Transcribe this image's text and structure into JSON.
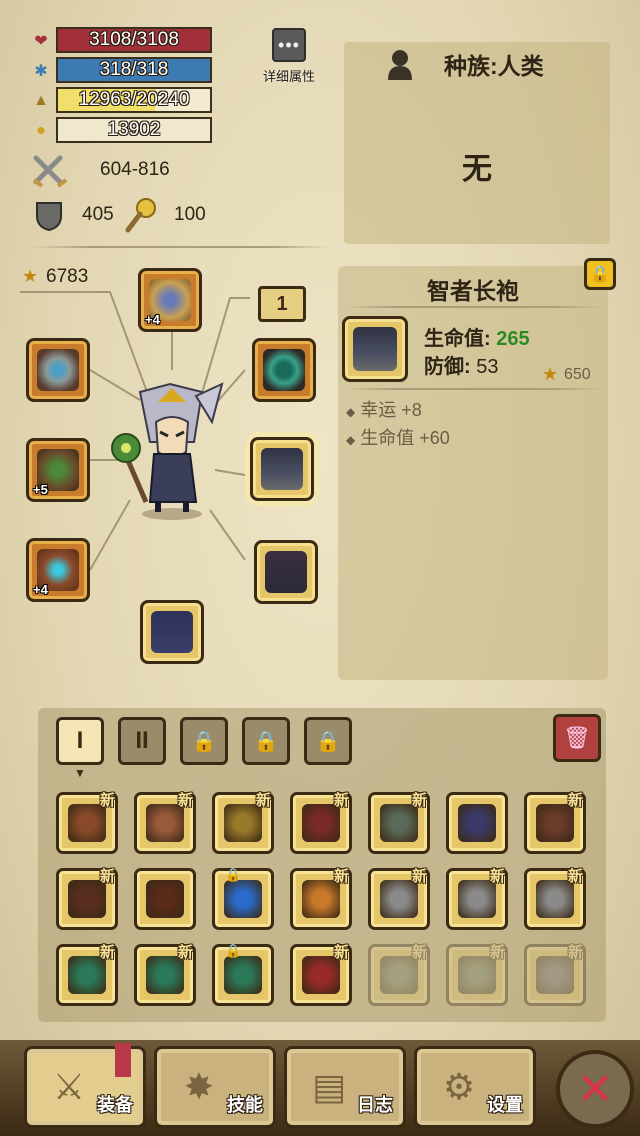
{
  "stats": {
    "hp": "3108/3108",
    "mp": "318/318",
    "exp": "12963/20240",
    "gold": "13902",
    "attack": "604-816",
    "defense": "405",
    "resist": "100",
    "score": "6783"
  },
  "detail_button": {
    "label": "详细属性",
    "icon": "dots-icon"
  },
  "race": {
    "label": "种族:人类",
    "value": "无"
  },
  "hero_slots": {
    "helmet_plus": "+4",
    "weapon_plus": "+5",
    "glove_plus": "+4",
    "level_tag": "1"
  },
  "item_info": {
    "name": "智者长袍",
    "hp_label": "生命值:",
    "hp_value": "265",
    "def_label": "防御:",
    "def_value": "53",
    "score": "650",
    "bonus1": "幸运 +8",
    "bonus2": "生命值 +60",
    "locked": true
  },
  "tabs": [
    {
      "label": "I",
      "state": "active"
    },
    {
      "label": "II",
      "state": "inactive"
    },
    {
      "label": "🔒",
      "state": "locked"
    },
    {
      "label": "🔒",
      "state": "locked"
    },
    {
      "label": "🔒",
      "state": "locked"
    }
  ],
  "new_badge": "新",
  "inventory_rows": [
    [
      {
        "kind": "hat",
        "new": true,
        "color": "#8a4a2a"
      },
      {
        "kind": "helmet",
        "new": true,
        "color": "#9a5a3a"
      },
      {
        "kind": "shoulder",
        "new": true,
        "color": "#9a7a2a"
      },
      {
        "kind": "robe",
        "new": true,
        "color": "#7a2a2a"
      },
      {
        "kind": "pants",
        "new": true,
        "color": "#5a6a5a"
      },
      {
        "kind": "boots",
        "new": false,
        "color": "#3a3a6a"
      },
      {
        "kind": "boots",
        "new": true,
        "color": "#6a3a2a"
      }
    ],
    [
      {
        "kind": "boots",
        "new": true,
        "color": "#5a2e1e"
      },
      {
        "kind": "bracer",
        "new": false,
        "color": "#5a2a1a"
      },
      {
        "kind": "amulet",
        "new": false,
        "color": "#2a6ac8",
        "locked": true
      },
      {
        "kind": "amulet",
        "new": true,
        "color": "#c87a2a"
      },
      {
        "kind": "claw",
        "new": true,
        "color": "#8a8a8a"
      },
      {
        "kind": "claw",
        "new": true,
        "color": "#8a8a8a"
      },
      {
        "kind": "claw",
        "new": true,
        "color": "#8a8a8a"
      }
    ],
    [
      {
        "kind": "ring",
        "new": true,
        "color": "#2a7a5a"
      },
      {
        "kind": "ring",
        "new": true,
        "color": "#2a7a5a"
      },
      {
        "kind": "ring",
        "new": false,
        "color": "#2a7a5a",
        "locked": true
      },
      {
        "kind": "ring",
        "new": true,
        "color": "#9a2a2a"
      },
      {
        "kind": "faded",
        "new": true,
        "color": "#6a7a6a",
        "faded": true
      },
      {
        "kind": "faded",
        "new": true,
        "color": "#6a7a6a",
        "faded": true
      },
      {
        "kind": "faded",
        "new": true,
        "color": "#6a6a7a",
        "faded": true
      }
    ]
  ],
  "nav": {
    "equip": "装备",
    "skills": "技能",
    "log": "日志",
    "settings": "设置"
  },
  "colors": {
    "hp": "#a2303a",
    "mp": "#3d7bb5",
    "exp": "#f2de6a",
    "green_value": "#2d8a22",
    "close_x": "#d8344a"
  }
}
